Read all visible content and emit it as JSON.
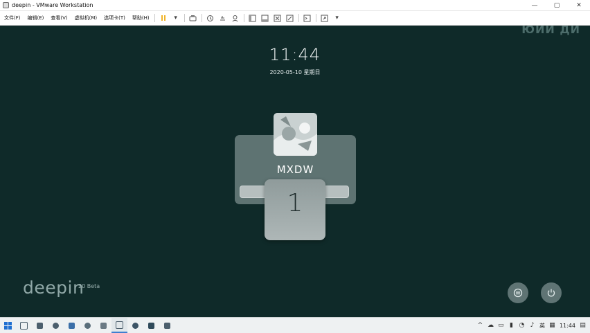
{
  "window": {
    "title": "deepin - VMware Workstation",
    "controls": {
      "minimize": "—",
      "maximize": "▢",
      "close": "✕"
    }
  },
  "menubar": {
    "menus": [
      "文件(F)",
      "编辑(E)",
      "查看(V)",
      "虚拟机(M)",
      "选项卡(T)",
      "帮助(H)"
    ]
  },
  "screen": {
    "watermark": "ЮИЙ ДИ",
    "clock": "11:44",
    "date": "2020-05-10 星期日",
    "username": "MXDW",
    "popup_text": "1",
    "logo": "deepin",
    "version": "20 Beta"
  },
  "taskbar": {
    "input_method": "英",
    "time": "11:44"
  },
  "colors": {
    "background": "#0f2a29",
    "accent": "#3e7fd0"
  }
}
